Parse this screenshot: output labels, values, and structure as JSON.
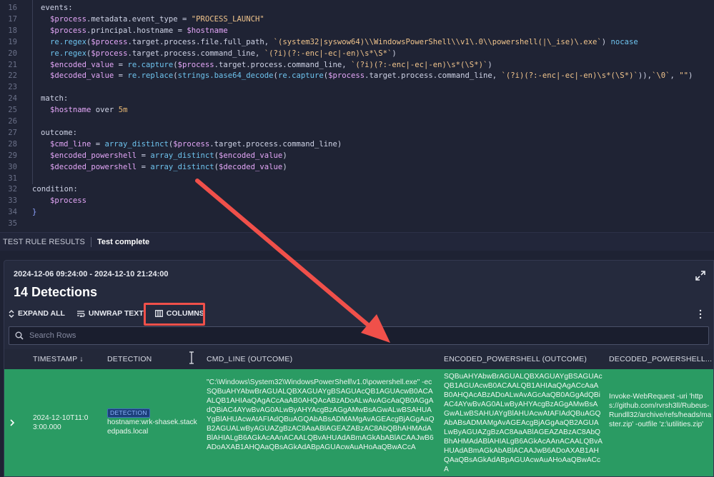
{
  "editor": {
    "lines": [
      {
        "n": "16",
        "indent": 1,
        "parts": [
          [
            "kw",
            "events:"
          ]
        ]
      },
      {
        "n": "17",
        "indent": 2,
        "parts": [
          [
            "var",
            "$process"
          ],
          [
            "kw",
            ".metadata.event_type = "
          ],
          [
            "str",
            "\"PROCESS_LAUNCH\""
          ]
        ]
      },
      {
        "n": "18",
        "indent": 2,
        "parts": [
          [
            "var",
            "$process"
          ],
          [
            "kw",
            ".principal.hostname = "
          ],
          [
            "var",
            "$hostname"
          ]
        ]
      },
      {
        "n": "19",
        "indent": 2,
        "parts": [
          [
            "fn",
            "re.regex"
          ],
          [
            "kw",
            "("
          ],
          [
            "var",
            "$process"
          ],
          [
            "kw",
            ".target.process.file.full_path, "
          ],
          [
            "str",
            "`(system32|syswow64)\\\\WindowsPowerShell\\\\v1\\.0\\\\powershell(|\\_ise)\\.exe`"
          ],
          [
            "kw",
            ") "
          ],
          [
            "fn",
            "nocase"
          ]
        ]
      },
      {
        "n": "20",
        "indent": 2,
        "parts": [
          [
            "fn",
            "re.regex"
          ],
          [
            "kw",
            "("
          ],
          [
            "var",
            "$process"
          ],
          [
            "kw",
            ".target.process.command_line, "
          ],
          [
            "str",
            "`(?i)(?:-enc|-ec|-en)\\s*\\S*`"
          ],
          [
            "kw",
            ")"
          ]
        ]
      },
      {
        "n": "21",
        "indent": 2,
        "parts": [
          [
            "var",
            "$encoded_value"
          ],
          [
            "kw",
            " = "
          ],
          [
            "fn",
            "re.capture"
          ],
          [
            "kw",
            "("
          ],
          [
            "var",
            "$process"
          ],
          [
            "kw",
            ".target.process.command_line, "
          ],
          [
            "str",
            "`(?i)(?:-enc|-ec|-en)\\s*(\\S*)`"
          ],
          [
            "kw",
            ")"
          ]
        ]
      },
      {
        "n": "22",
        "indent": 2,
        "parts": [
          [
            "var",
            "$decoded_value"
          ],
          [
            "kw",
            " = "
          ],
          [
            "fn",
            "re.replace"
          ],
          [
            "kw",
            "("
          ],
          [
            "fn",
            "strings.base64_decode"
          ],
          [
            "kw",
            "("
          ],
          [
            "fn",
            "re.capture"
          ],
          [
            "kw",
            "("
          ],
          [
            "var",
            "$process"
          ],
          [
            "kw",
            ".target.process.command_line, "
          ],
          [
            "str",
            "`(?i)(?:-enc|-ec|-en)\\s*(\\S*)`"
          ],
          [
            "kw",
            ")),"
          ],
          [
            "str",
            "`\\0`"
          ],
          [
            "kw",
            ", "
          ],
          [
            "str",
            "\"\""
          ],
          [
            "kw",
            ")"
          ]
        ]
      },
      {
        "n": "23",
        "indent": 0,
        "parts": []
      },
      {
        "n": "24",
        "indent": 1,
        "parts": [
          [
            "kw",
            "match:"
          ]
        ]
      },
      {
        "n": "25",
        "indent": 2,
        "parts": [
          [
            "var",
            "$hostname"
          ],
          [
            "kw",
            " over "
          ],
          [
            "num",
            "5m"
          ]
        ]
      },
      {
        "n": "26",
        "indent": 0,
        "parts": []
      },
      {
        "n": "27",
        "indent": 1,
        "parts": [
          [
            "kw",
            "outcome:"
          ]
        ]
      },
      {
        "n": "28",
        "indent": 2,
        "parts": [
          [
            "var",
            "$cmd_line"
          ],
          [
            "kw",
            " = "
          ],
          [
            "fn",
            "array_distinct"
          ],
          [
            "kw",
            "("
          ],
          [
            "var",
            "$process"
          ],
          [
            "kw",
            ".target.process.command_line)"
          ]
        ]
      },
      {
        "n": "29",
        "indent": 2,
        "parts": [
          [
            "var",
            "$encoded_powershell"
          ],
          [
            "kw",
            " = "
          ],
          [
            "fn",
            "array_distinct"
          ],
          [
            "kw",
            "("
          ],
          [
            "var",
            "$encoded_value"
          ],
          [
            "kw",
            ")"
          ]
        ]
      },
      {
        "n": "30",
        "indent": 2,
        "parts": [
          [
            "var",
            "$decoded_powershell"
          ],
          [
            "kw",
            " = "
          ],
          [
            "fn",
            "array_distinct"
          ],
          [
            "kw",
            "("
          ],
          [
            "var",
            "$decoded_value"
          ],
          [
            "kw",
            ")"
          ]
        ]
      },
      {
        "n": "31",
        "indent": 0,
        "parts": []
      },
      {
        "n": "32",
        "indent": 0,
        "parts": [
          [
            "kw",
            "condition:"
          ]
        ]
      },
      {
        "n": "33",
        "indent": 2,
        "parts": [
          [
            "var",
            "$process"
          ]
        ]
      },
      {
        "n": "34",
        "indent": 0,
        "parts": [
          [
            "op",
            "}"
          ]
        ]
      },
      {
        "n": "35",
        "indent": 0,
        "parts": []
      }
    ]
  },
  "status": {
    "title": "TEST RULE RESULTS",
    "state": "Test complete"
  },
  "results": {
    "range": "2024-12-06 09:24:00 - 2024-12-10 21:24:00",
    "count": "14 Detections",
    "toolbar": {
      "expand_all": "EXPAND ALL",
      "unwrap_text": "UNWRAP TEXT",
      "columns": "COLUMNS"
    },
    "search": {
      "placeholder": "Search Rows"
    },
    "columns": {
      "timestamp": "TIMESTAMP ↓",
      "detection": "DETECTION",
      "cmd_line": "CMD_LINE (OUTCOME)",
      "encoded": "ENCODED_POWERSHELL (OUTCOME)",
      "decoded": "DECODED_POWERSHELL..."
    },
    "row": {
      "timestamp": "2024-12-10T11:03:00.000",
      "badge": "DETECTION",
      "detection": "hostname:wrk-shasek.stackedpads.local",
      "cmd_line": "\"C:\\Windows\\System32\\WindowsPowerShell\\v1.0\\powershell.exe\" -ec SQBuAHYAbwBrAGUALQBXAGUAYgBSAGUAcQB1AGUAcwB0ACAALQB1AHIAaQAgACcAaAB0AHQAcABzADoALwAvAGcAaQB0AGgAdQBiAC4AYwBvAG0ALwByAHYAcgBzAGgAMwBsAGwALwBSAHUAYgBlAHUAcwAtAFIAdQBuAGQAbABsADMAMgAvAGEAcgBjAGgAaQB2AGUALwByAGUAZgBzAC8AaABlAGEAZABzAC8AbQBhAHMAdABlAHIALgB6AGkAcAAnACAALQBvAHUAdABmAGkAbABlACAAJwB6ADoAXAB1AHQAaQBsAGkAdABpAGUAcwAuAHoAaQBwACcA",
      "encoded": "SQBuAHYAbwBrAGUALQBXAGUAYgBSAGUAcQB1AGUAcwB0ACAALQB1AHIAaQAgACcAaAB0AHQAcABzADoALwAvAGcAaQB0AGgAdQBiAC4AYwBvAG0ALwByAHYAcgBzAGgAMwBsAGwALwBSAHUAYgBlAHUAcwAtAFIAdQBuAGQAbABsADMAMgAvAGEAcgBjAGgAaQB2AGUALwByAGUAZgBzAC8AaABlAGEAZABzAC8AbQBhAHMAdABlAHIALgB6AGkAcAAnACAALQBvAHUAdABmAGkAbABlACAAJwB6ADoAXAB1AHQAaQBsAGkAdABpAGUAcwAuAHoAaQBwACcA",
      "decoded": "Invoke-WebRequest -uri 'https://github.com/rvrsh3ll/Rubeus-Rundll32/archive/refs/heads/master.zip' -outfile 'z:\\utilities.zip'"
    }
  },
  "colors": {
    "row_highlight": "#2a9b63",
    "annotation": "#f0504a",
    "badge_bg": "#1c3f7a"
  },
  "icons": [
    "expand-icon",
    "unwrap-icon",
    "columns-icon",
    "fullscreen-icon",
    "more-vertical-icon",
    "search-icon",
    "chevron-right-icon",
    "column-resize-icon"
  ]
}
